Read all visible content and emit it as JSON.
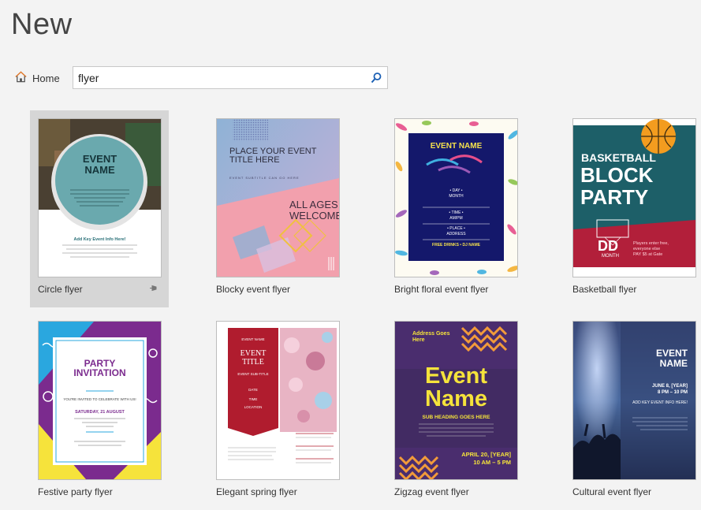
{
  "header": {
    "title": "New"
  },
  "nav": {
    "home_label": "Home"
  },
  "search": {
    "value": "flyer"
  },
  "templates": [
    {
      "label": "Circle flyer",
      "pinned": true,
      "thumb": {
        "title_lines": [
          "EVENT",
          "NAME"
        ],
        "footer_heading": "Add Key Event Info Here!",
        "colors": {
          "circle": "#6aa9ae",
          "accent": "#2a7078"
        }
      }
    },
    {
      "label": "Blocky event flyer",
      "thumb": {
        "title": "PLACE YOUR EVENT TITLE HERE",
        "subtitle": "EVENT SUBTITLE CAN GO HERE",
        "welcome_lines": [
          "ALL AGES",
          "WELCOME"
        ],
        "colors": {
          "blue": "#8fb2d6",
          "pink": "#f2a0ad",
          "gold": "#f0c040"
        }
      }
    },
    {
      "label": "Bright floral event flyer",
      "thumb": {
        "title": "EVENT NAME",
        "day_label": "• DAY •",
        "month": "MONTH",
        "time_label": "• TIME •",
        "ampm": "AM/PM",
        "place_label": "• PLACE •",
        "address": "ADDRESS",
        "drinks": "FREE DRINKS • DJ NAME",
        "colors": {
          "navy": "#14186b",
          "yellow": "#f4e04d"
        }
      }
    },
    {
      "label": "Basketball flyer",
      "thumb": {
        "title_lines": [
          "BASKETBALL",
          "BLOCK",
          "PARTY"
        ],
        "date_big": "DD",
        "month": "MONTH",
        "info_lines": [
          "Players enter free,",
          "everyone else",
          "PAY $5 at Gate"
        ],
        "colors": {
          "teal": "#1d5f68",
          "red": "#b21f3a",
          "orange": "#f39c1f"
        }
      }
    },
    {
      "label": "Festive party flyer",
      "thumb": {
        "title_lines": [
          "PARTY",
          "INVITATION"
        ],
        "invite": "YOU'RE INVITED TO CELEBRATE WITH US!",
        "date": "SATURDAY, 21 AUGUST",
        "colors": {
          "purple": "#7b2b8e",
          "blue": "#2aa7df",
          "yellow": "#f6e33b"
        }
      }
    },
    {
      "label": "Elegant spring flyer",
      "thumb": {
        "top_label": "EVENT NAME",
        "title_lines": [
          "EVENT",
          "TITLE"
        ],
        "subtitle": "EVENT SUB-TITLE",
        "date": "DATE",
        "time": "TIME",
        "location": "LOCATION",
        "colors": {
          "red": "#b01c2e",
          "blossom": "#e8b4c4"
        }
      }
    },
    {
      "label": "Zigzag event flyer",
      "thumb": {
        "address_lines": [
          "Address Goes",
          "Here"
        ],
        "title_lines": [
          "Event",
          "Name"
        ],
        "subheading": "SUB HEADING GOES HERE",
        "date": "APRIL 20, [YEAR]",
        "time": "10 AM – 5 PM",
        "colors": {
          "purple": "#4a2d6e",
          "yellow": "#f5e33b",
          "orange": "#f29b3a"
        }
      }
    },
    {
      "label": "Cultural event flyer",
      "thumb": {
        "title_lines": [
          "EVENT",
          "NAME"
        ],
        "date_lines": [
          "JUNE 8, [YEAR]",
          "8 PM – 10 PM"
        ],
        "info": "ADD KEY EVENT INFO HERE!",
        "colors": {
          "deep": "#2b3a66",
          "highlight": "#a9c3e8"
        }
      }
    }
  ]
}
